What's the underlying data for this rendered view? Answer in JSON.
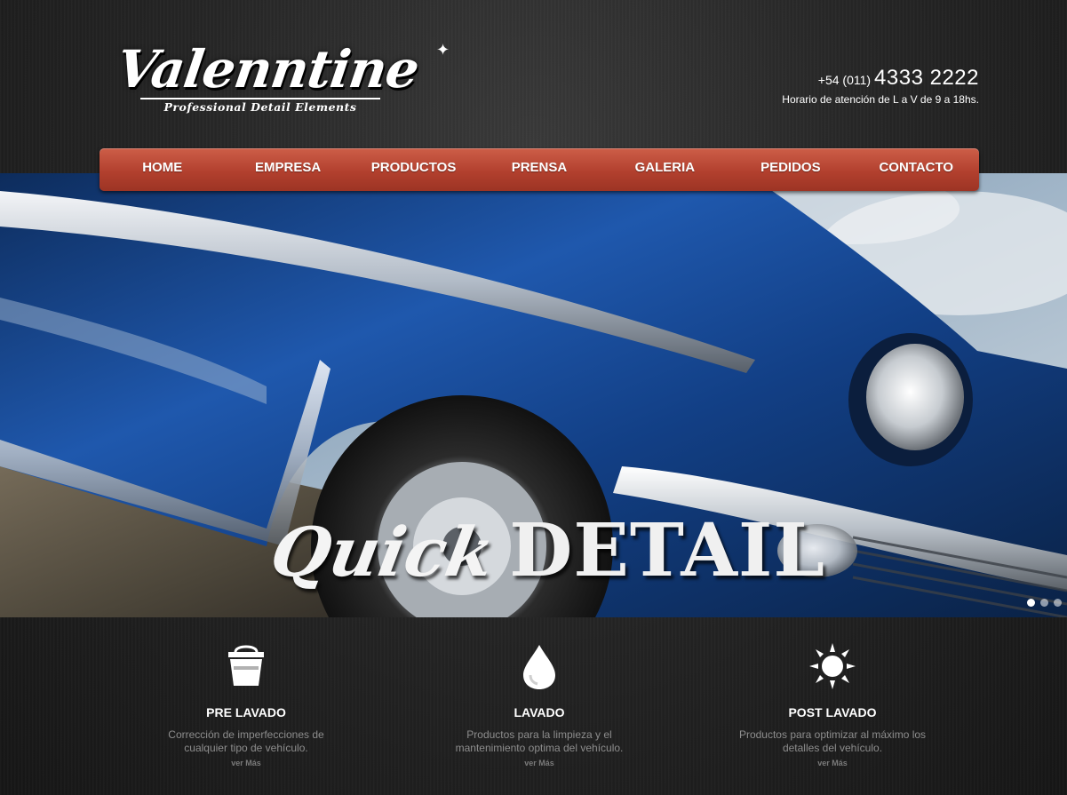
{
  "header": {
    "logo_text": "Valenntine",
    "logo_tagline": "Professional Detail Elements",
    "phone_prefix": "+54 (011)",
    "phone_number": "4333 2222",
    "hours": "Horario de atención de L a V de 9 a 18hs."
  },
  "nav": {
    "items": [
      {
        "label": "HOME"
      },
      {
        "label": "EMPRESA"
      },
      {
        "label": "PRODUCTOS"
      },
      {
        "label": "PRENSA"
      },
      {
        "label": "GALERIA"
      },
      {
        "label": "PEDIDOS"
      },
      {
        "label": "CONTACTO"
      }
    ]
  },
  "hero": {
    "title_script": "Quick",
    "title_bold": "DETAIL",
    "slides": 3,
    "active_slide": 1
  },
  "features": [
    {
      "icon": "bucket-icon",
      "title": "PRE LAVADO",
      "desc_line1": "Corrección de imperfecciones de",
      "desc_line2": "cualquier tipo de vehículo.",
      "more": "ver Más"
    },
    {
      "icon": "water-drop-icon",
      "title": "LAVADO",
      "desc_line1": "Productos para la limpieza y el",
      "desc_line2": "mantenimiento optima del vehículo.",
      "more": "ver Más"
    },
    {
      "icon": "sun-icon",
      "title": "POST LAVADO",
      "desc_line1": "Productos para optimizar al máximo los",
      "desc_line2": "detalles del vehículo.",
      "more": "ver Más"
    }
  ],
  "colors": {
    "nav_red": "#b2402e",
    "page_dark": "#1f1f1f",
    "car_blue": "#1b4f9e"
  }
}
